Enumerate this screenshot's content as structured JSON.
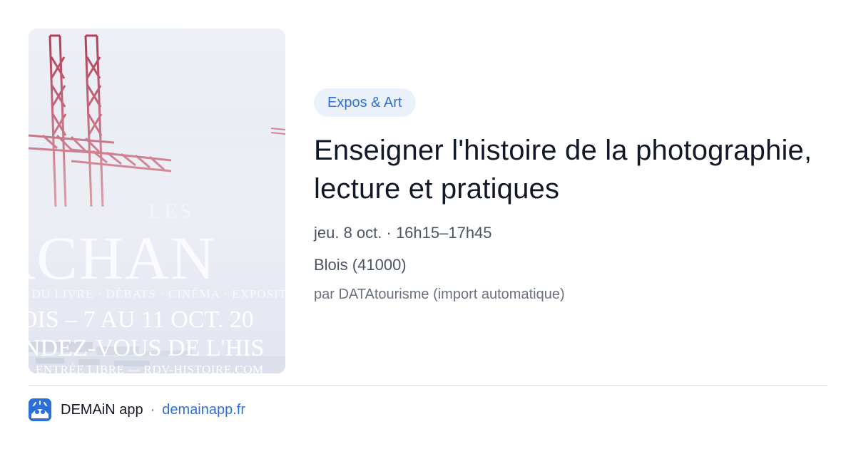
{
  "poster": {
    "les": "LES",
    "big": "RCHAN",
    "sub": "N DU LIVRE · DÉBATS · CINÉMA · EXPOSIT",
    "date": "OIS – 7 AU 11 OCT. 20",
    "rdv": "NDEZ-VOUS DE L'HIS",
    "url": "ENTRÉE LIBRE — RDV-HISTOIRE.COM"
  },
  "event": {
    "category": "Expos & Art",
    "title": "Enseigner l'histoire de la photographie, lecture et pratiques",
    "datetime": "jeu. 8 oct. · 16h15–17h45",
    "place": "Blois (41000)",
    "source": "par DATAtourisme (import automatique)"
  },
  "footer": {
    "app_name": "DEMAiN app",
    "separator": "·",
    "link": "demainapp.fr",
    "icon": "demain-app-icon"
  },
  "colors": {
    "accent": "#2f6fd6",
    "badge_bg": "#eaf1fb",
    "title": "#111827",
    "muted": "#4b5563"
  }
}
